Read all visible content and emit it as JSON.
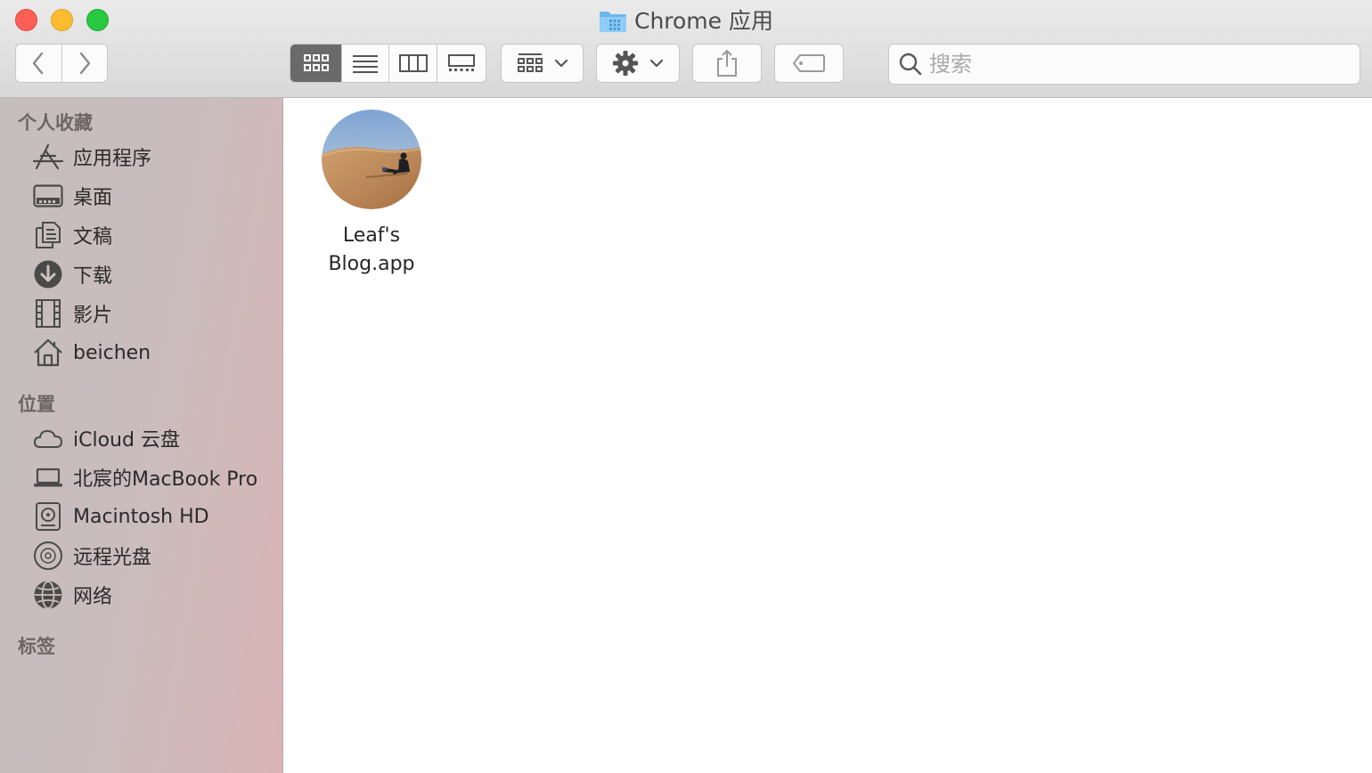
{
  "window": {
    "title": "Chrome 应用"
  },
  "toolbar": {
    "view_modes": [
      "icon-view",
      "list-view",
      "column-view",
      "gallery-view"
    ],
    "active_view": "icon-view",
    "search_placeholder": "搜索"
  },
  "sidebar": {
    "sections": [
      {
        "title": "个人收藏",
        "items": [
          {
            "label": "应用程序",
            "icon": "applications-icon"
          },
          {
            "label": "桌面",
            "icon": "desktop-icon"
          },
          {
            "label": "文稿",
            "icon": "documents-icon"
          },
          {
            "label": "下载",
            "icon": "downloads-icon"
          },
          {
            "label": "影片",
            "icon": "movies-icon"
          },
          {
            "label": "beichen",
            "icon": "home-icon"
          }
        ]
      },
      {
        "title": "位置",
        "items": [
          {
            "label": "iCloud 云盘",
            "icon": "cloud-icon"
          },
          {
            "label": "北宸的MacBook Pro",
            "icon": "laptop-icon"
          },
          {
            "label": "Macintosh HD",
            "icon": "hard-drive-icon"
          },
          {
            "label": "远程光盘",
            "icon": "disc-icon"
          },
          {
            "label": "网络",
            "icon": "network-icon"
          }
        ]
      },
      {
        "title": "标签",
        "items": []
      }
    ]
  },
  "content": {
    "files": [
      {
        "name": "Leaf's Blog.app",
        "name_line1": "Leaf's",
        "name_line2": "Blog.app",
        "icon": "app-avatar-icon"
      }
    ]
  },
  "colors": {
    "close": "#fd5f57",
    "minimize": "#febc2e",
    "maximize": "#28c840",
    "folder_accent": "#5eaee8"
  }
}
